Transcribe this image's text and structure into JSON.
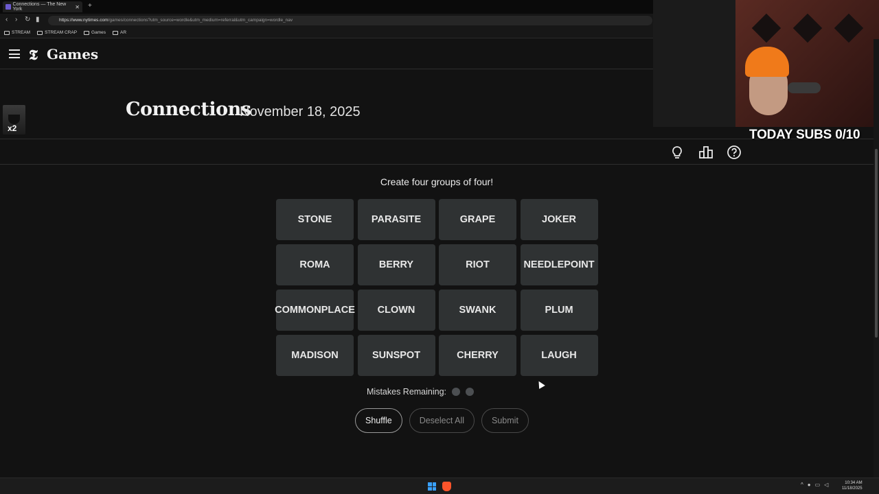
{
  "browser": {
    "tab_title": "Connections — The New York",
    "tab_close": "✕",
    "new_tab": "+",
    "url_host": "https://www.nytimes.com",
    "url_path": "/games/connections?utm_source=wordle&utm_medium=referral&utm_campaign=wordle_nav",
    "bookmarks": [
      "STREAM",
      "STREAM CRAP",
      "Games",
      "AR"
    ]
  },
  "header": {
    "logo_mark": "𝕿",
    "logo_text": "Games"
  },
  "game": {
    "title": "Connections",
    "date": "November 18, 2025",
    "instructions": "Create four groups of four!",
    "tiles": [
      "STONE",
      "PARASITE",
      "GRAPE",
      "JOKER",
      "ROMA",
      "BERRY",
      "RIOT",
      "NEEDLEPOINT",
      "COMMONPLACE",
      "CLOWN",
      "SWANK",
      "PLUM",
      "MADISON",
      "SUNSPOT",
      "CHERRY",
      "LAUGH"
    ],
    "mistakes_label": "Mistakes Remaining:",
    "mistakes_remaining": 2,
    "buttons": {
      "shuffle": "Shuffle",
      "deselect": "Deselect All",
      "submit": "Submit"
    }
  },
  "toolbar_icons": [
    "hint-bulb-icon",
    "stats-bar-icon",
    "help-question-icon"
  ],
  "overlay": {
    "avatar_badge": "x2",
    "subs_text": "TODAY SUBS 0/10"
  },
  "taskbar": {
    "time": "10:34 AM",
    "date": "11/18/2025"
  },
  "colors": {
    "background": "#121212",
    "tile": "#2f3233",
    "text": "#e8e8e8"
  }
}
